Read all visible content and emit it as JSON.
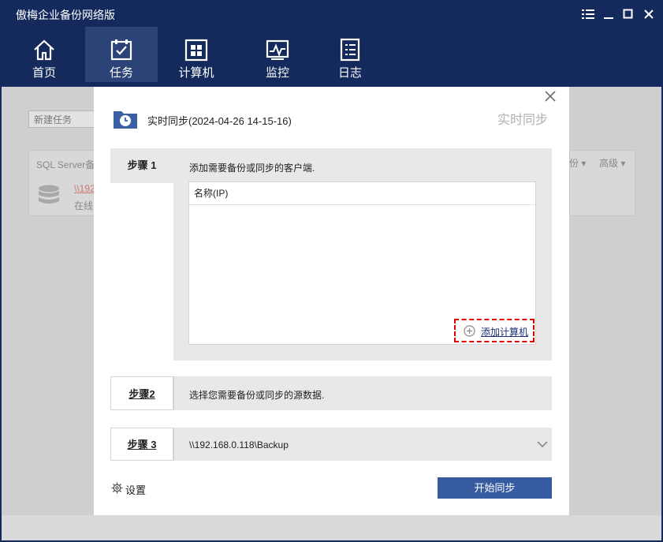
{
  "app": {
    "title": "傲梅企业备份网络版",
    "window_controls": [
      "menu-icon",
      "minimize-icon",
      "maximize-icon",
      "close-icon"
    ]
  },
  "nav": {
    "items": [
      {
        "label": "首页",
        "icon": "home-icon"
      },
      {
        "label": "任务",
        "icon": "task-icon",
        "active": true
      },
      {
        "label": "计算机",
        "icon": "computer-icon"
      },
      {
        "label": "监控",
        "icon": "monitor-icon"
      },
      {
        "label": "日志",
        "icon": "log-icon"
      }
    ]
  },
  "background": {
    "new_task": "新建任务",
    "sql_server": "SQL Server备",
    "server_link": "\\\\192",
    "status": "在线",
    "backup_col": "份",
    "advanced_col": "高级"
  },
  "dialog": {
    "title": "实时同步(2024-04-26 14-15-16)",
    "right_title": "实时同步",
    "step1": {
      "label": "步骤 1",
      "description": "添加需要备份或同步的客户端.",
      "column_header": "名称(IP)",
      "add_button": "添加计算机"
    },
    "step2": {
      "label": "步骤2",
      "description": "选择您需要备份或同步的源数据."
    },
    "step3": {
      "label": "步骤 3",
      "path": "\\\\192.168.0.118\\Backup"
    },
    "settings_label": "设置",
    "start_button": "开始同步"
  },
  "colors": {
    "header_bg": "#142a5c",
    "nav_active": "#2b4377",
    "primary_button": "#375ba0",
    "highlight_border": "#e00000"
  }
}
